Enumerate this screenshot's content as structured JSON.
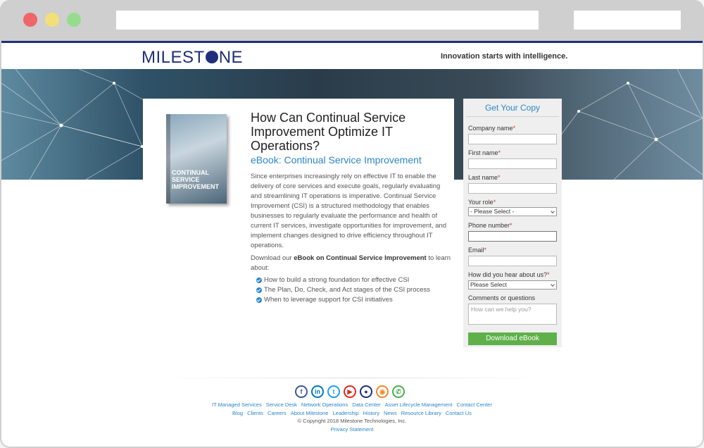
{
  "header": {
    "logo": "MILEST",
    "logo_end": "NE",
    "tagline": "Innovation starts with intelligence."
  },
  "content": {
    "ebook_cover_title": "Continual Service Improvement",
    "headline": "How Can Continual Service Improvement Optimize IT Operations?",
    "subhead": "eBook: Continual Service Improvement",
    "body": "Since enterprises increasingly rely on effective IT to enable the delivery of core services and execute goals, regularly evaluating and streamlining IT operations is imperative. Continual Service Improvement (CSI) is a structured methodology that enables businesses to regularly evaluate the performance and health of current IT services, investigate opportunities for improvement, and implement changes designed to drive efficiency throughout IT operations.",
    "download_prefix": "Download our ",
    "download_bold": "eBook on Continual Service Improvement",
    "download_suffix": " to learn about:",
    "bullets": [
      "How to build a strong foundation for effective CSI",
      "The Plan, Do, Check, and Act stages of the CSI process",
      "When to leverage support for CSI initiatives"
    ]
  },
  "form": {
    "title": "Get Your Copy",
    "company_label": "Company name",
    "first_label": "First name",
    "last_label": "Last name",
    "role_label": "Your role",
    "role_value": "- Please Select -",
    "phone_label": "Phone number",
    "email_label": "Email",
    "hear_label": "How did you hear about us?",
    "hear_value": "Please Select",
    "comments_label": "Comments or questions",
    "comments_placeholder": "How can we help you?",
    "required_mark": "*",
    "submit": "Download eBook"
  },
  "social_icons": [
    {
      "name": "facebook-icon",
      "glyph": "f",
      "color": "#3b5998"
    },
    {
      "name": "linkedin-icon",
      "glyph": "in",
      "color": "#0077b5"
    },
    {
      "name": "twitter-icon",
      "glyph": "t",
      "color": "#1da1f2"
    },
    {
      "name": "youtube-icon",
      "glyph": "▶",
      "color": "#e02a20"
    },
    {
      "name": "milestone-icon",
      "glyph": "●",
      "color": "#1f2f7a"
    },
    {
      "name": "rss-icon",
      "glyph": "◉",
      "color": "#f0892f"
    },
    {
      "name": "phone-icon",
      "glyph": "✆",
      "color": "#4caf50"
    }
  ],
  "footer": {
    "row1": [
      "IT Managed Services",
      "Service Desk",
      "Network Operations",
      "Data Center",
      "Asset Lifecycle Management",
      "Contact Center"
    ],
    "row2": [
      "Blog",
      "Clients",
      "Careers",
      "About Milestone",
      "Leadership",
      "History",
      "News",
      "Resource Library",
      "Contact Us"
    ],
    "copyright": "© Copyright 2018 Milestone Technologies, Inc.",
    "privacy": "Privacy Statement"
  }
}
